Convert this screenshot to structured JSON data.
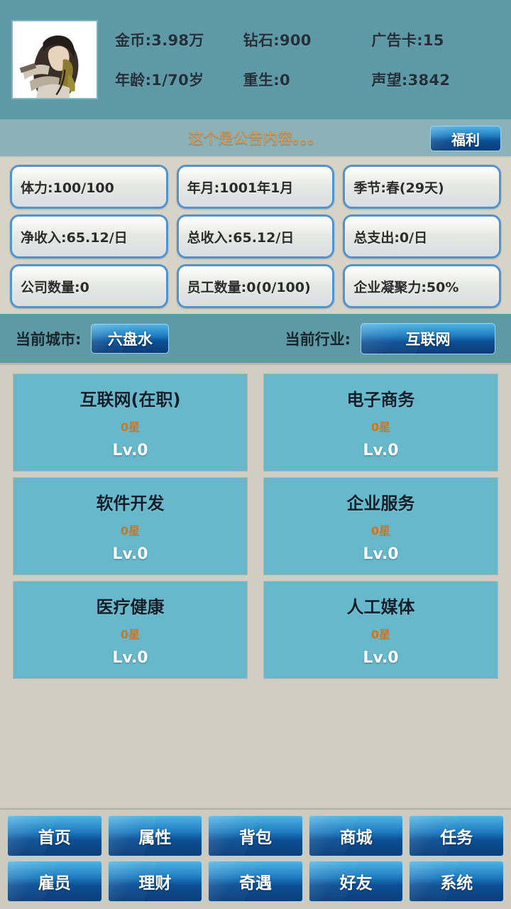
{
  "header": {
    "avatar_name": "player-avatar",
    "stats": [
      {
        "key": "gold",
        "text": "金币:3.98万"
      },
      {
        "key": "diamond",
        "text": "钻石:900"
      },
      {
        "key": "ad_card",
        "text": "广告卡:15"
      },
      {
        "key": "age",
        "text": "年龄:1/70岁"
      },
      {
        "key": "rebirth",
        "text": "重生:0"
      },
      {
        "key": "reputation",
        "text": "声望:3842"
      }
    ]
  },
  "notice": {
    "text": "这个是公告内容。。。",
    "welfare_label": "福利"
  },
  "stats_panel": [
    {
      "key": "stamina",
      "text": "体力:100/100"
    },
    {
      "key": "date",
      "text": "年月:1001年1月"
    },
    {
      "key": "season",
      "text": "季节:春(29天)"
    },
    {
      "key": "net_income",
      "text": "净收入:65.12/日"
    },
    {
      "key": "total_income",
      "text": "总收入:65.12/日"
    },
    {
      "key": "total_expense",
      "text": "总支出:0/日"
    },
    {
      "key": "company_count",
      "text": "公司数量:0"
    },
    {
      "key": "employee_count",
      "text": "员工数量:0(0/100)"
    },
    {
      "key": "cohesion",
      "text": "企业凝聚力:50%"
    }
  ],
  "selector": {
    "city_label": "当前城市:",
    "city_value": "六盘水",
    "industry_label": "当前行业:",
    "industry_value": "互联网"
  },
  "industries": [
    {
      "title": "互联网(在职)",
      "stars": "0星",
      "level": "Lv.0"
    },
    {
      "title": "电子商务",
      "stars": "0星",
      "level": "Lv.0"
    },
    {
      "title": "软件开发",
      "stars": "0星",
      "level": "Lv.0"
    },
    {
      "title": "企业服务",
      "stars": "0星",
      "level": "Lv.0"
    },
    {
      "title": "医疗健康",
      "stars": "0星",
      "level": "Lv.0"
    },
    {
      "title": "人工媒体",
      "stars": "0星",
      "level": "Lv.0"
    }
  ],
  "bottom_nav": [
    {
      "key": "home",
      "label": "首页"
    },
    {
      "key": "attribute",
      "label": "属性"
    },
    {
      "key": "backpack",
      "label": "背包"
    },
    {
      "key": "shop",
      "label": "商城"
    },
    {
      "key": "task",
      "label": "任务"
    },
    {
      "key": "employee",
      "label": "雇员"
    },
    {
      "key": "finance",
      "label": "理财"
    },
    {
      "key": "adventure",
      "label": "奇遇"
    },
    {
      "key": "friend",
      "label": "好友"
    },
    {
      "key": "system",
      "label": "系统"
    }
  ],
  "colors": {
    "header_teal": "#5e9aa6",
    "notice_bar": "#8ab2b8",
    "panel_bg": "#d8d3c7",
    "content_bg": "#d2cdc2",
    "card_blue": "#68b8cc",
    "button_blue": "#1f7cc0",
    "stars_orange": "#d2741c",
    "notice_text": "#c79a63"
  }
}
